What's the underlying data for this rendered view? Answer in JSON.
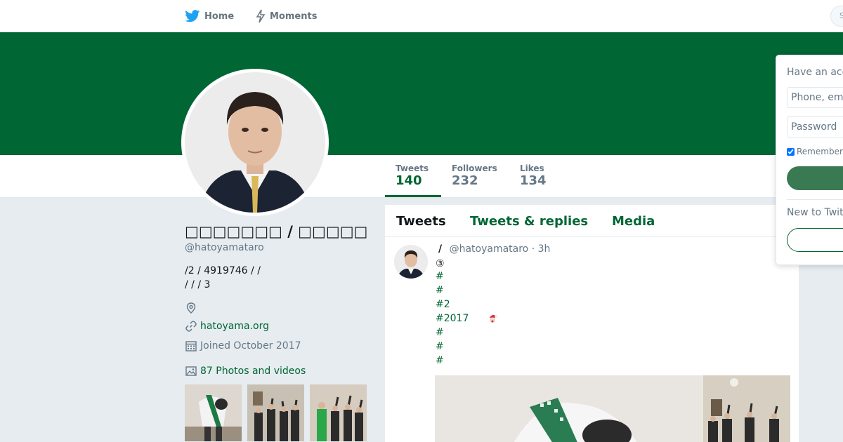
{
  "colors": {
    "brand": "#006633",
    "link": "#006633",
    "muted": "#657786",
    "background": "#e6ecf0"
  },
  "nav": {
    "home_label": "Home",
    "moments_label": "Moments",
    "search_placeholder": "S"
  },
  "profile": {
    "name": "□□□□□□□ / □□□□□",
    "handle": "@hatoyamataro",
    "bio": "/2 / 4919746 /    /\n/  /  / 3",
    "url": "hatoyama.org",
    "joined": "Joined October 2017",
    "photos_label": "87 Photos and videos"
  },
  "stats": [
    {
      "label": "Tweets",
      "value": "140"
    },
    {
      "label": "Followers",
      "value": "232"
    },
    {
      "label": "Likes",
      "value": "134"
    }
  ],
  "timeline": {
    "tabs": [
      "Tweets",
      "Tweets & replies",
      "Media"
    ],
    "tweet": {
      "fullname": "/",
      "handle": "@hatoyamataro",
      "time": "3h",
      "lines": [
        "③",
        "#",
        "#",
        "#2",
        "#2017",
        "#",
        "#",
        "#"
      ]
    }
  },
  "login": {
    "title": "Have an account?",
    "phone_placeholder": "Phone, email or username",
    "password_placeholder": "Password",
    "remember_label": "Remember me",
    "new_to": "New to Twitter?"
  }
}
